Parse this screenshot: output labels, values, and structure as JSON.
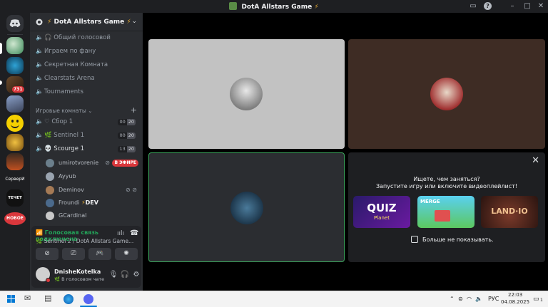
{
  "window": {
    "title": "DotA Allstars Game"
  },
  "rail": {
    "badge_count": "731",
    "server_label": "СерверИ",
    "channel_label": "ТЕЧЕТ",
    "new_label": "НОВОЕ"
  },
  "server": {
    "name": "DotA Allstars Game"
  },
  "channels": [
    {
      "name": "Общий голосовой",
      "type": "voice"
    },
    {
      "name": "Играем по фану",
      "type": "voice"
    },
    {
      "name": "Секретная Комната",
      "type": "voice"
    },
    {
      "name": "Clearstats Arena",
      "type": "voice"
    },
    {
      "name": "Tournaments",
      "type": "voice"
    }
  ],
  "category": {
    "name": "Игровые комнаты"
  },
  "game_rooms": [
    {
      "name": "Сбор 1",
      "count_in": "00",
      "count_max": "20"
    },
    {
      "name": "Sentinel 1",
      "count_in": "00",
      "count_max": "20"
    },
    {
      "name": "Scourge 1",
      "count_in": "13",
      "count_max": "20"
    }
  ],
  "voice_users": [
    {
      "name": "umirotvorenie",
      "live": "В ЭФИРЕ",
      "color": "#6b7f8c"
    },
    {
      "name": "Ayyub",
      "color": "#9aa4b0"
    },
    {
      "name": "Deminov",
      "color": "#a57a55"
    },
    {
      "name": "Froundi",
      "tag": "DEV",
      "color": "#4b6a8c"
    },
    {
      "name": "GCardinal",
      "color": "#c8c8c8"
    }
  ],
  "voice_panel": {
    "status": "Голосовая связь подключена",
    "location": "Sentinel 2 / DotA Allstars Game..."
  },
  "user_panel": {
    "name": "DnisheKotelka",
    "status": "В голосовом чате"
  },
  "activity": {
    "question": "Ищете, чем заняться?",
    "prompt": "Запустите игру или включите видеоплейлист!",
    "games": [
      {
        "name": "QUIZ",
        "sub": "Planet"
      },
      {
        "name": "MERGE",
        "sub": ""
      },
      {
        "name": "LAND·IO",
        "sub": ""
      }
    ],
    "dont_show": "Больше не показывать."
  },
  "taskbar": {
    "lang": "РУС",
    "time": "22:03",
    "date": "04.08.2025",
    "notifications": "1"
  },
  "colors": {
    "accent_green": "#23a55a",
    "live_red": "#da373c",
    "rail_bg": "#1e1f22",
    "channels_bg": "#2b2d31"
  }
}
